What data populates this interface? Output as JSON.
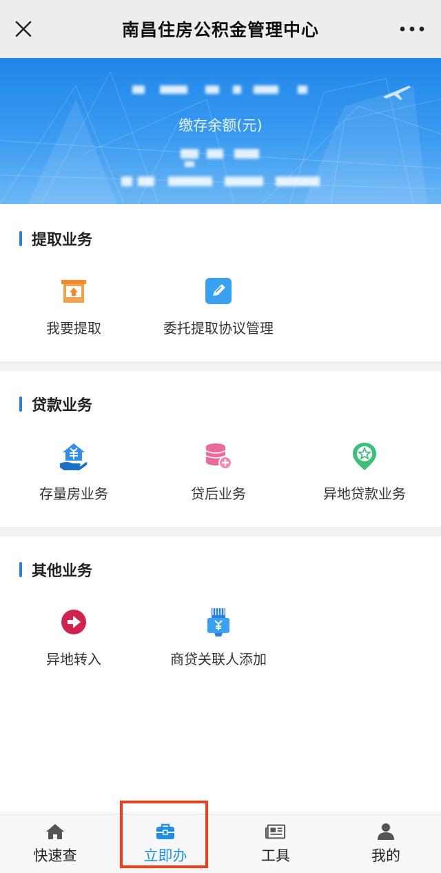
{
  "titlebar": {
    "title": "南昌住房公积金管理中心",
    "close_icon": "close-icon",
    "more_icon": "more-icon"
  },
  "banner": {
    "balance_label": "缴存余额(元)",
    "background_color": "#2b8eea"
  },
  "sections": [
    {
      "title": "提取业务",
      "items": [
        {
          "label": "我要提取",
          "icon": "withdraw-tray-icon"
        },
        {
          "label": "委托提取协议管理",
          "icon": "edit-pencil-icon"
        }
      ]
    },
    {
      "title": "贷款业务",
      "items": [
        {
          "label": "存量房业务",
          "icon": "house-yuan-hand-icon"
        },
        {
          "label": "贷后业务",
          "icon": "coin-stack-plus-icon"
        },
        {
          "label": "异地贷款业务",
          "icon": "location-star-icon"
        }
      ]
    },
    {
      "title": "其他业务",
      "items": [
        {
          "label": "异地转入",
          "icon": "arrow-right-circle-icon"
        },
        {
          "label": "商贷关联人添加",
          "icon": "yuan-hand-card-icon"
        }
      ]
    }
  ],
  "bottom_nav": {
    "active_index": 1,
    "tabs": [
      {
        "label": "快速查",
        "icon": "home-icon"
      },
      {
        "label": "立即办",
        "icon": "briefcase-icon"
      },
      {
        "label": "工具",
        "icon": "newspaper-icon"
      },
      {
        "label": "我的",
        "icon": "user-icon"
      }
    ]
  },
  "colors": {
    "accent": "#2b7fe0",
    "active_tab": "#1e8ee6",
    "highlight_box": "#f23d1b"
  }
}
